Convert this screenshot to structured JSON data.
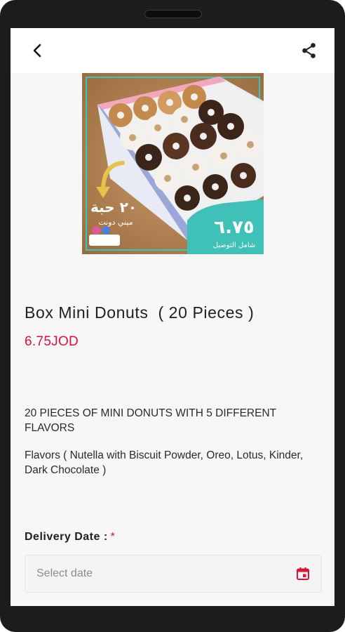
{
  "product": {
    "title": "Box Mini Donuts  ( 20 Pieces )",
    "price": "6.75JOD",
    "image_overlay": {
      "count_text": "٢٠ حبة",
      "subtitle_text": "ميني دونت",
      "price_badge_text": "٦.٧٥",
      "price_badge_sub": "شامل التوصيل"
    }
  },
  "description": {
    "line1": "20 PIECES OF MINI DONUTS WITH 5 DIFFERENT FLAVORS",
    "line2": "Flavors ( Nutella with Biscuit Powder, Oreo, Lotus, Kinder, Dark Chocolate )"
  },
  "delivery": {
    "label": "Delivery Date :",
    "required_mark": "*",
    "placeholder": "Select date"
  },
  "colors": {
    "accent": "#e0103a",
    "badge": "#3fc1b8"
  },
  "icons": {
    "back": "chevron-left",
    "share": "share",
    "calendar": "calendar"
  }
}
